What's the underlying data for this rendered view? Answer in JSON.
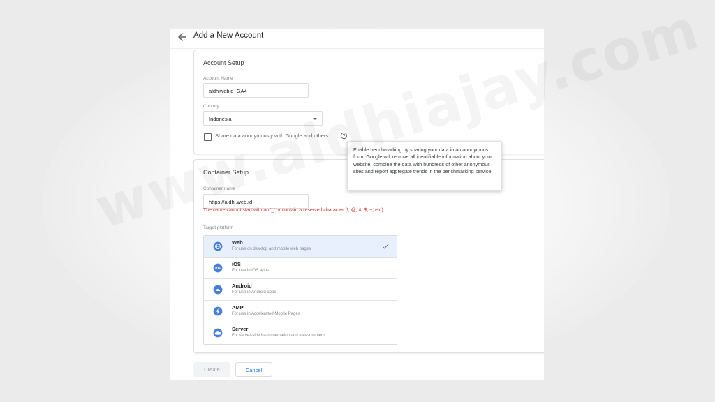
{
  "header": {
    "title": "Add a New Account"
  },
  "account_setup": {
    "title": "Account Setup",
    "account_name_label": "Account Name",
    "account_name_value": "aldhiwebid_GA4",
    "country_label": "Country",
    "country_value": "Indonesia",
    "share_data_label": "Share data anonymously with Google and others",
    "share_data_checked": false
  },
  "tooltip": {
    "text": "Enable benchmarking by sharing your data in an anonymous form. Google will remove all identifiable information about your website, combine the data with hundreds of other anonymous sites and report aggregate trends in the benchmarking service."
  },
  "container_setup": {
    "title": "Container Setup",
    "container_name_label": "Container name",
    "container_name_value": "https://aldhi.web.id",
    "error_text": "The name cannot start with an '_' or contain a reserved character (!, @, #, $, ~, etc)",
    "target_platform_label": "Target platform",
    "platforms": [
      {
        "name": "Web",
        "description": "For use on desktop and mobile web pages",
        "icon": "globe-icon",
        "selected": true
      },
      {
        "name": "iOS",
        "description": "For use in iOS apps",
        "icon": "ios-icon",
        "selected": false
      },
      {
        "name": "Android",
        "description": "For use in Android apps",
        "icon": "android-icon",
        "selected": false
      },
      {
        "name": "AMP",
        "description": "For use in Accelerated Mobile Pages",
        "icon": "amp-icon",
        "selected": false
      },
      {
        "name": "Server",
        "description": "For server-side instrumentation and measurement",
        "icon": "cloud-icon",
        "selected": false
      }
    ]
  },
  "actions": {
    "create_label": "Create",
    "cancel_label": "Cancel"
  },
  "watermark": {
    "text": "www.aldhiajay.com"
  },
  "colors": {
    "accent": "#1a73e8",
    "error": "#d93025",
    "selected_bg": "#e8f0fe"
  }
}
